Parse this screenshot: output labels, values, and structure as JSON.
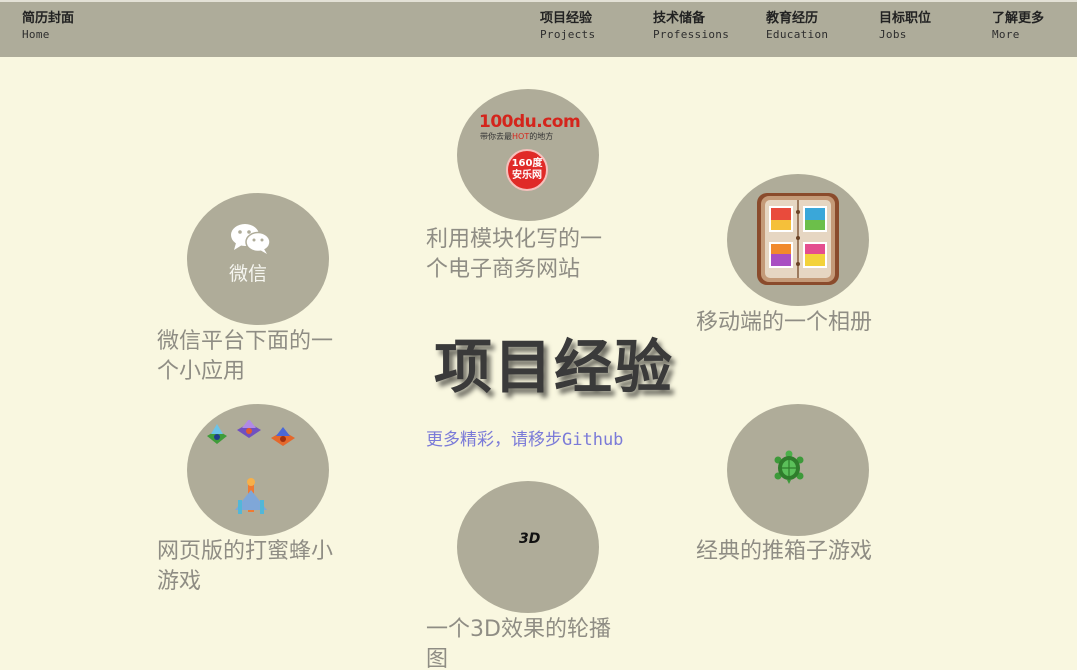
{
  "nav": {
    "home": {
      "cn": "简历封面",
      "en": "Home"
    },
    "items": [
      {
        "cn": "项目经验",
        "en": "Projects"
      },
      {
        "cn": "技术储备",
        "en": "Professions"
      },
      {
        "cn": "教育经历",
        "en": "Education"
      },
      {
        "cn": "目标职位",
        "en": "Jobs"
      },
      {
        "cn": "了解更多",
        "en": "More"
      }
    ]
  },
  "main": {
    "title": "项目经验",
    "github_link": "更多精彩，请移步Github"
  },
  "projects": [
    {
      "icon": "wechat-icon",
      "icon_text": "微信",
      "caption_lines": [
        "微信平台下面的一",
        "个小应用"
      ]
    },
    {
      "icon": "100du-logo",
      "logo_text": "100du.com",
      "logo_sub_pre": "带你去最",
      "logo_sub_hot": "HOT",
      "logo_sub_post": "的地方",
      "badge_text": [
        "160",
        "度",
        "安乐网"
      ],
      "caption_lines": [
        "利用模块化写的一",
        "个电子商务网站"
      ]
    },
    {
      "icon": "photo-album-icon",
      "caption_lines": [
        "移动端的一个相册"
      ]
    },
    {
      "icon": "bee-game-icon",
      "caption_lines": [
        "网页版的打蜜蜂小",
        "游戏"
      ]
    },
    {
      "icon": "3d-icon",
      "icon_text": "3D",
      "caption_lines": [
        "一个3D效果的轮播",
        "图"
      ]
    },
    {
      "icon": "turtle-icon",
      "caption_lines": [
        "经典的推箱子游戏"
      ]
    }
  ],
  "colors": {
    "background": "#f9f7e0",
    "navbar": "#aeac9a",
    "circle": "#afac99",
    "caption": "#8f8d84",
    "link": "#7b7bd8"
  }
}
